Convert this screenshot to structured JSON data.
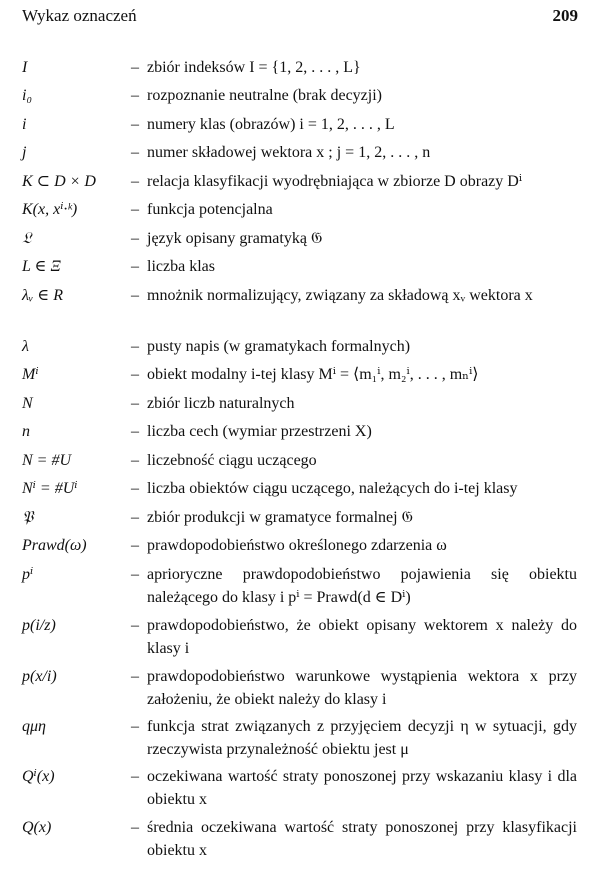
{
  "header": {
    "title": "Wykaz oznaczeń",
    "page_number": "209"
  },
  "rows": [
    {
      "symbol": "I",
      "description": "zbiór indeksów I = {1, 2, . . . , L}"
    },
    {
      "symbol": "i₀",
      "description": "rozpoznanie neutralne (brak decyzji)"
    },
    {
      "symbol": "i",
      "description": "numery klas (obrazów) i = 1, 2, . . . , L"
    },
    {
      "symbol": "j",
      "description": "numer składowej wektora x ; j = 1, 2, . . . , n"
    },
    {
      "symbol": "K ⊂ D × D",
      "description": "relacja klasyfikacji wyodrębniająca w zbiorze D obrazy Dⁱ"
    },
    {
      "symbol": "K(x, xⁱ·ᵏ)",
      "description": "funkcja potencjalna"
    },
    {
      "symbol": "𝔏",
      "description": "język opisany gramatyką 𝔊"
    },
    {
      "symbol": "L ∈ Ξ",
      "description": "liczba klas"
    },
    {
      "symbol": "λᵥ ∈ R",
      "description": "mnożnik normalizujący, związany za składową xᵥ wektora x"
    },
    {
      "symbol": "λ",
      "description": "pusty napis (w gramatykach formalnych)"
    },
    {
      "symbol": "Mⁱ",
      "description": "obiekt modalny i-tej klasy Mⁱ = ⟨m₁ⁱ, m₂ⁱ, . . . , mₙⁱ⟩"
    },
    {
      "symbol": "N",
      "description": "zbiór liczb naturalnych"
    },
    {
      "symbol": "n",
      "description": "liczba cech (wymiar przestrzeni X)"
    },
    {
      "symbol": "N = #U",
      "description": "liczebność ciągu uczącego"
    },
    {
      "symbol": "Nⁱ = #Uⁱ",
      "description": "liczba obiektów ciągu uczącego, należących do i-tej klasy"
    },
    {
      "symbol": "𝔓",
      "description": "zbiór produkcji w gramatyce formalnej 𝔊"
    },
    {
      "symbol": "Prawd(ω)",
      "description": "prawdopodobieństwo określonego zdarzenia ω"
    },
    {
      "symbol": "pⁱ",
      "description": "aprioryczne prawdopodobieństwo pojawienia się obiektu należącego do klasy i pⁱ = Prawd(d ∈ Dⁱ)"
    },
    {
      "symbol": "p(i/z)",
      "description": "prawdopodobieństwo, że obiekt opisany wektorem x należy do klasy i"
    },
    {
      "symbol": "p(x/i)",
      "description": "prawdopodobieństwo warunkowe wystąpienia wektora x przy założeniu, że obiekt należy do klasy i"
    },
    {
      "symbol": "qμη",
      "description": "funkcja strat związanych z przyjęciem decyzji η w sytuacji, gdy rzeczywista przynależność obiektu jest μ"
    },
    {
      "symbol": "Qⁱ(x)",
      "description": "oczekiwana wartość straty ponoszonej przy wskazaniu klasy i dla obiektu x"
    },
    {
      "symbol": "Q(x)",
      "description": "średnia oczekiwana wartość straty ponoszonej przy klasyfikacji obiektu x"
    }
  ]
}
